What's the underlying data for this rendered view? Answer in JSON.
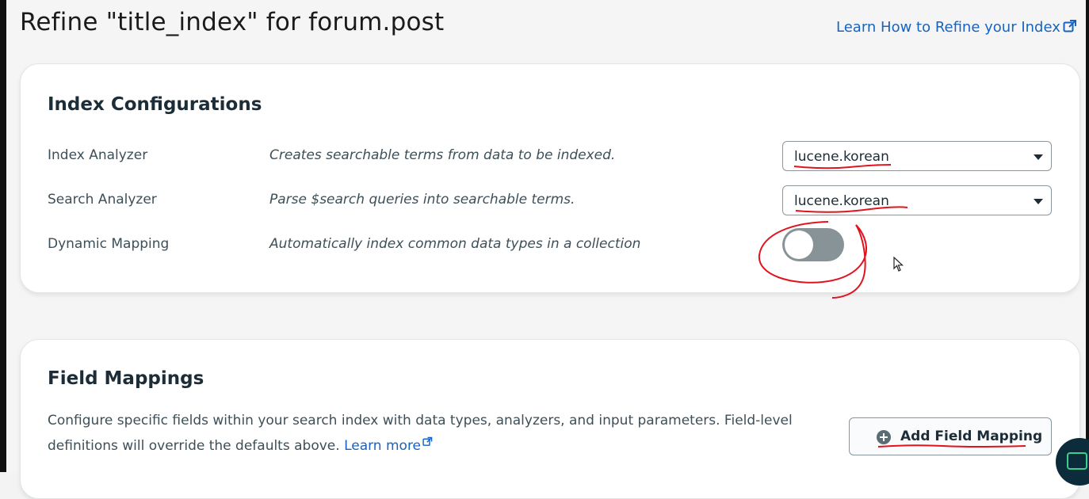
{
  "header": {
    "title": "Refine \"title_index\" for forum.post",
    "learn_link": "Learn How to Refine your Index"
  },
  "index_config": {
    "title": "Index Configurations",
    "rows": [
      {
        "label": "Index Analyzer",
        "description": "Creates searchable terms from data to be indexed.",
        "value": "lucene.korean"
      },
      {
        "label": "Search Analyzer",
        "description": "Parse $search queries into searchable terms.",
        "value": "lucene.korean"
      },
      {
        "label": "Dynamic Mapping",
        "description": "Automatically index common data types in a collection",
        "enabled": false
      }
    ]
  },
  "field_mappings": {
    "title": "Field Mappings",
    "description": "Configure specific fields within your search index with data types, analyzers, and input parameters. Field-level definitions will override the defaults above.",
    "learn_more": "Learn more",
    "add_button": "Add Field Mapping"
  },
  "colors": {
    "link": "#1664c0",
    "toggle_off": "#889397",
    "annotation": "#e0141e",
    "chat_bg": "#0d2c3b"
  },
  "icons": [
    "external-link-icon",
    "chevron-down-icon",
    "plus-circle-icon",
    "chat-icon",
    "mouse-cursor-icon"
  ]
}
